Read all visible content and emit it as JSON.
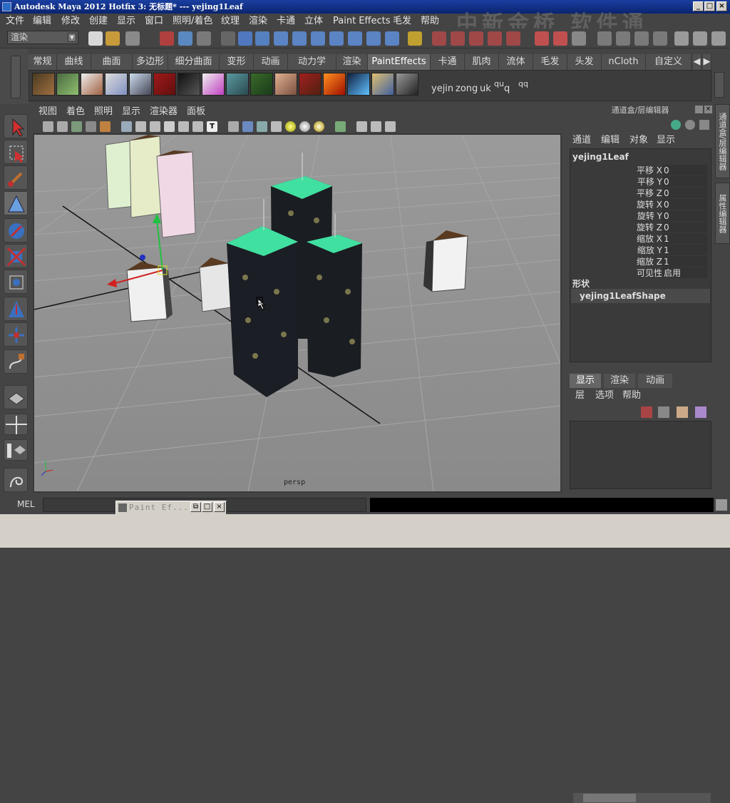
{
  "window": {
    "title": "Autodesk Maya 2012 Hotfix 3: 无标题*   ---   yejing1Leaf",
    "controls": [
      "_",
      "□",
      "×"
    ]
  },
  "watermark": "中新金桥 软件通",
  "menu": [
    "文件",
    "编辑",
    "修改",
    "创建",
    "显示",
    "窗口",
    "照明/着色",
    "纹理",
    "渲染",
    "卡通",
    "立体",
    "Paint Effects",
    "毛发",
    "帮助"
  ],
  "status": {
    "mode_select": "渲染"
  },
  "shelf": {
    "tabs": [
      "常规",
      "曲线",
      "曲面",
      "多边形",
      "细分曲面",
      "变形",
      "动画",
      "动力学",
      "渲染",
      "PaintEffects",
      "卡通",
      "肌肉",
      "流体",
      "毛发",
      "头发",
      "nCloth",
      "自定义"
    ],
    "active_tab": "PaintEffects",
    "text_buttons": [
      "yejin",
      "zong",
      "uk",
      "qu",
      "q",
      "qq"
    ]
  },
  "viewport": {
    "menu": [
      "视图",
      "着色",
      "照明",
      "显示",
      "渲染器",
      "面板"
    ],
    "camera_label": "persp"
  },
  "channel_box": {
    "header": "通道盒/层编辑器",
    "menu": [
      "通道",
      "编辑",
      "对象",
      "显示"
    ],
    "object": "yejing1Leaf",
    "attributes": [
      {
        "name": "平移 X",
        "value": "0"
      },
      {
        "name": "平移 Y",
        "value": "0"
      },
      {
        "name": "平移 Z",
        "value": "0"
      },
      {
        "name": "旋转 X",
        "value": "0"
      },
      {
        "name": "旋转 Y",
        "value": "0"
      },
      {
        "name": "旋转 Z",
        "value": "0"
      },
      {
        "name": "缩放 X",
        "value": "1"
      },
      {
        "name": "缩放 Y",
        "value": "1"
      },
      {
        "name": "缩放 Z",
        "value": "1"
      },
      {
        "name": "可见性",
        "value": "启用"
      }
    ],
    "shapes_header": "形状",
    "shape_name": "yejing1LeafShape"
  },
  "side_tabs": [
    "通道盒/层编辑器",
    "属性编辑器"
  ],
  "layer_editor": {
    "tabs": [
      "显示",
      "渲染",
      "动画"
    ],
    "menu": [
      "层",
      "选项",
      "帮助"
    ]
  },
  "command_line": {
    "label": "MEL"
  },
  "minimized_window": {
    "title": "Paint Ef..."
  }
}
